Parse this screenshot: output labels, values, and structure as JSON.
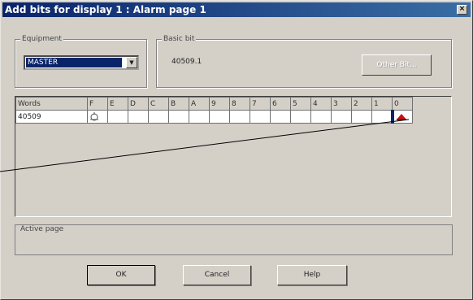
{
  "window": {
    "title": "Add bits for display 1 : Alarm page 1",
    "close_glyph": "×"
  },
  "equipment": {
    "label": "Equipment",
    "selected": "MASTER"
  },
  "basic_bit": {
    "label": "Basic bit",
    "value": "40509.1",
    "other_bit_button": "Other Bit..."
  },
  "bits_table": {
    "words_header": "Words",
    "bit_headers": [
      "F",
      "E",
      "D",
      "C",
      "B",
      "A",
      "9",
      "8",
      "7",
      "6",
      "5",
      "4",
      "3",
      "2",
      "1",
      "0"
    ],
    "rows": [
      {
        "word": "40509"
      }
    ],
    "selected_bit": "0",
    "icons": {
      "empty_bit": "bit-empty-icon",
      "alarm_bit": "alarm-bit-icon"
    }
  },
  "active_page": {
    "label": "Active page"
  },
  "buttons": {
    "ok": "OK",
    "cancel": "Cancel",
    "help": "Help"
  },
  "colors": {
    "title_bar": "#0a246a",
    "selection": "#0a246a",
    "alarm_icon": "#d01010"
  }
}
